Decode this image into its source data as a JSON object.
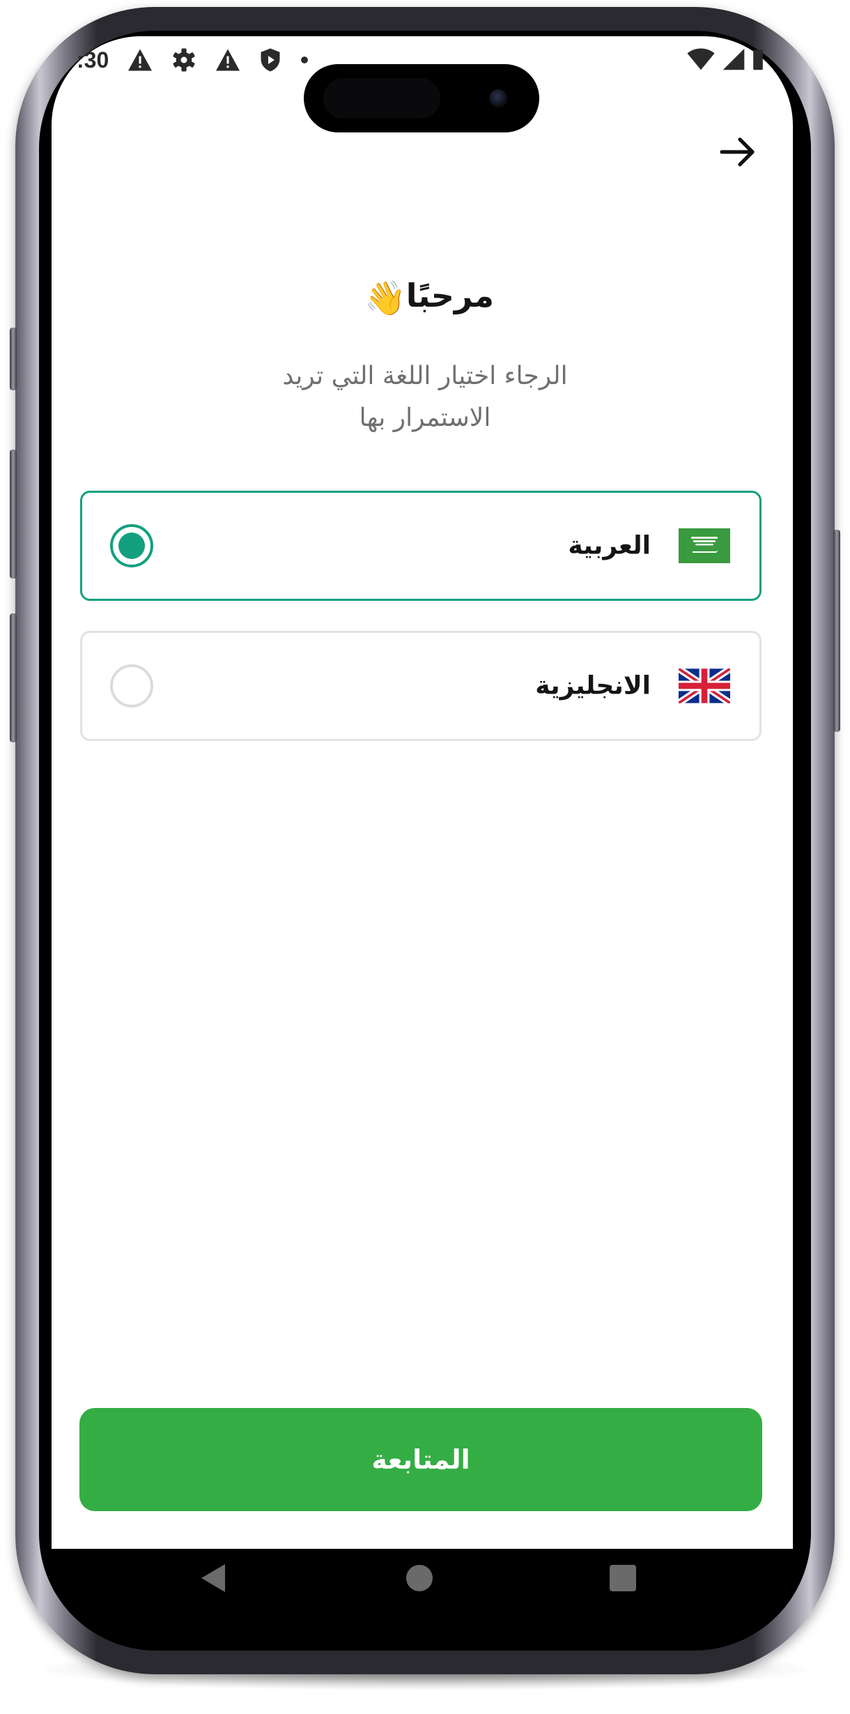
{
  "status_bar": {
    "time": ":30",
    "left_icons": [
      "warning-icon",
      "settings-gear-icon",
      "warning-icon",
      "shield-play-icon",
      "dot-icon"
    ],
    "right_icons": [
      "wifi-icon",
      "signal-icon",
      "battery-icon"
    ]
  },
  "header": {
    "back_icon": "arrow-right-icon"
  },
  "welcome": {
    "title": "مرحبًا",
    "emoji": "👋",
    "subtitle_line1": "الرجاء اختيار اللغة التي تريد",
    "subtitle_line2": "الاستمرار بها"
  },
  "languages": [
    {
      "label": "العربية",
      "flag": "saudi-flag-icon",
      "selected": true
    },
    {
      "label": "الانجليزية",
      "flag": "uk-flag-icon",
      "selected": false
    }
  ],
  "continue_button": {
    "label": "المتابعة"
  },
  "colors": {
    "accent": "#13a07f",
    "button": "#34ad44",
    "text": "#151515",
    "subtitle": "#6f6f6f"
  },
  "nav_bar": [
    "back-triangle-icon",
    "home-circle-icon",
    "recents-square-icon"
  ]
}
